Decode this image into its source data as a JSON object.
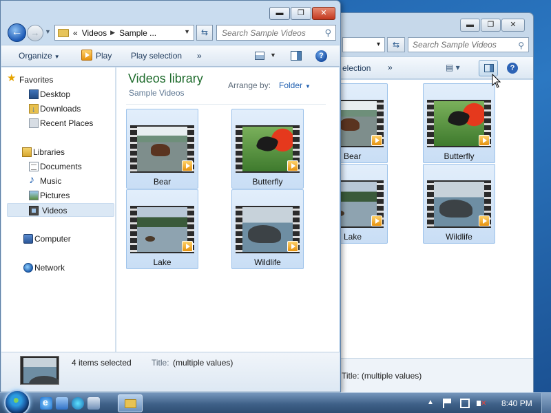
{
  "back_window": {
    "address_tail": "▾",
    "search_placeholder": "Search Sample Videos",
    "toolbar_text": "election",
    "toolbar_more": "»",
    "tiles": [
      {
        "caption": "Bear"
      },
      {
        "caption": "Butterfly"
      },
      {
        "caption": "Lake"
      },
      {
        "caption": "Wildlife"
      }
    ],
    "status": "Title:  (multiple values)"
  },
  "window": {
    "min_label": "▬",
    "max_label": "❐",
    "close_label": "✕"
  },
  "nav": {
    "back_glyph": "←",
    "forward_glyph": "→",
    "breadcrumb_prefix": "«",
    "breadcrumb": [
      "Videos",
      "Sample ..."
    ],
    "refresh_glyph": "⇆"
  },
  "search": {
    "placeholder": "Search Sample Videos"
  },
  "toolbar": {
    "organize": "Organize",
    "play": "Play",
    "play_selection": "Play selection",
    "more": "»",
    "help": "?"
  },
  "sidebar": {
    "favorites": {
      "label": "Favorites",
      "items": [
        {
          "label": "Desktop",
          "icon": "desktop-icon"
        },
        {
          "label": "Downloads",
          "icon": "downloads-icon"
        },
        {
          "label": "Recent Places",
          "icon": "recent-places-icon"
        }
      ]
    },
    "libraries": {
      "label": "Libraries",
      "items": [
        {
          "label": "Documents",
          "icon": "documents-icon"
        },
        {
          "label": "Music",
          "icon": "music-icon"
        },
        {
          "label": "Pictures",
          "icon": "pictures-icon"
        },
        {
          "label": "Videos",
          "icon": "videos-icon",
          "selected": true
        }
      ]
    },
    "computer": {
      "label": "Computer"
    },
    "network": {
      "label": "Network"
    }
  },
  "library": {
    "title": "Videos library",
    "subtitle": "Sample Videos",
    "arrange_label": "Arrange by:",
    "arrange_value": "Folder",
    "tiles": [
      {
        "caption": "Bear",
        "selected": true
      },
      {
        "caption": "Butterfly",
        "selected": true
      },
      {
        "caption": "Lake",
        "selected": true
      },
      {
        "caption": "Wildlife",
        "selected": true
      }
    ]
  },
  "status": {
    "count": "4 items selected",
    "title_label": "Title:",
    "title_value": "(multiple values)"
  },
  "taskbar": {
    "time": "8:40 PM"
  },
  "colors": {
    "library_title": "#1e6b2c",
    "link_blue": "#1f5fb0",
    "selection_fill": "#c9def5",
    "selection_border": "#9cc2ea"
  }
}
